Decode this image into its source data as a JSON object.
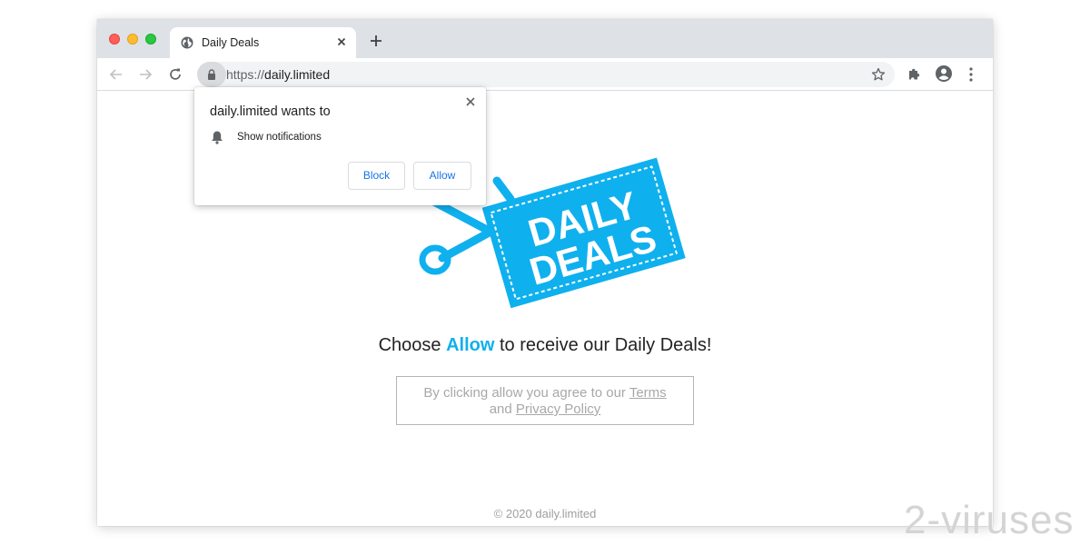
{
  "tab": {
    "title": "Daily Deals",
    "favicon": "globe-icon"
  },
  "toolbar": {
    "url_scheme": "https://",
    "url_host": "daily.limited",
    "icons": [
      "back-arrow-icon",
      "forward-arrow-icon",
      "reload-icon",
      "lock-icon",
      "star-icon",
      "puzzle-icon",
      "profile-icon",
      "kebab-menu-icon"
    ]
  },
  "permission_prompt": {
    "title": "daily.limited wants to",
    "permission": "Show notifications",
    "block_label": "Block",
    "allow_label": "Allow"
  },
  "page": {
    "logo_line1": "DAILY",
    "logo_line2": "DEALS",
    "headline_before": "Choose",
    "headline_allow": "Allow",
    "headline_after": "to receive our Daily Deals!",
    "terms_prefix": "By clicking allow you agree to our",
    "terms_link": "Terms",
    "terms_and": "and",
    "privacy_link": "Privacy Policy",
    "footer": "© 2020 daily.limited"
  },
  "watermark": "2-viruses",
  "colors": {
    "brand_blue": "#0fb0ee",
    "link_blue": "#1a73e8",
    "tabstrip": "#dee1e6"
  }
}
